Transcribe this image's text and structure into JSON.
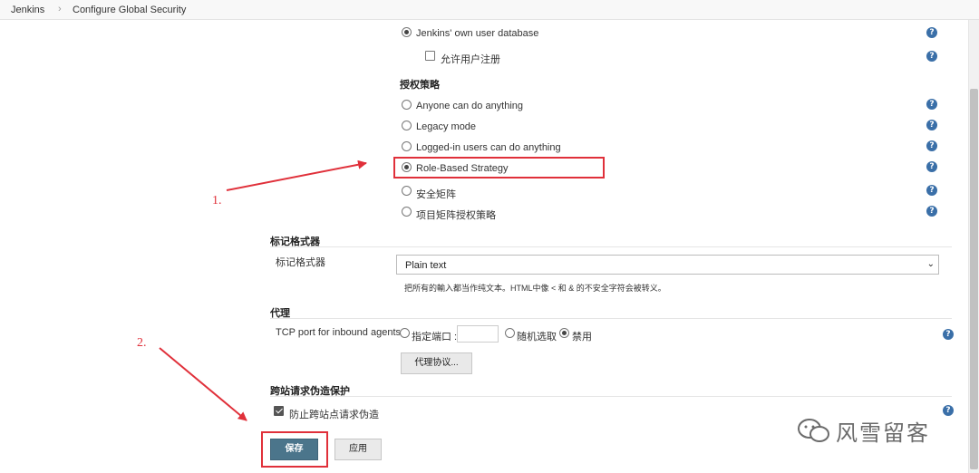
{
  "breadcrumb": {
    "root": "Jenkins",
    "separator": "›",
    "current": "Configure Global Security"
  },
  "security_realm": {
    "own_db_label": "Jenkins' own user database",
    "allow_signup_label": "允许用户注册"
  },
  "authorization": {
    "title": "授权策略",
    "options": [
      {
        "label": "Anyone can do anything",
        "checked": false
      },
      {
        "label": "Legacy mode",
        "checked": false
      },
      {
        "label": "Logged-in users can do anything",
        "checked": false
      },
      {
        "label": "Role-Based Strategy",
        "checked": true
      },
      {
        "label": "安全矩阵",
        "checked": false
      },
      {
        "label": "项目矩阵授权策略",
        "checked": false
      }
    ]
  },
  "markup": {
    "section_title": "标记格式器",
    "field_label": "标记格式器",
    "select_value": "Plain text",
    "hint": "把所有的輸入都当作纯文本。HTML中像 < 和 & 的不安全字符会被转义。"
  },
  "agent": {
    "section_title": "代理",
    "tcp_label": "TCP port for inbound agents",
    "fixed_label": "指定端口 :",
    "fixed_value": "",
    "random_label": "随机选取",
    "disable_label": "禁用",
    "selected": "disable",
    "protocols_button": "代理协议..."
  },
  "csrf": {
    "section_title": "跨站请求伪造保护",
    "prevent_label": "防止跨站点请求伪造",
    "checked": true
  },
  "buttons": {
    "save": "保存",
    "apply": "应用"
  },
  "annotations": {
    "step1": "1.",
    "step2": "2."
  },
  "watermark": "风雪留客",
  "colors": {
    "accent": "#e0303a",
    "save_bg": "#4b758b",
    "help_icon": "#3a6fa8"
  }
}
